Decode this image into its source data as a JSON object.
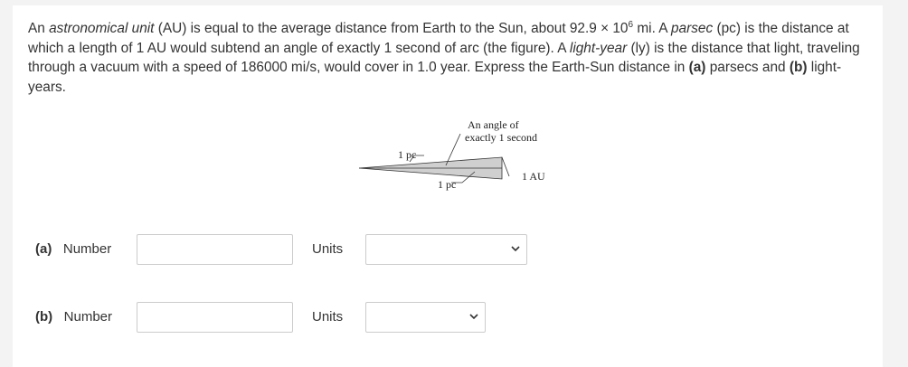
{
  "problem": {
    "p1": "An ",
    "p2": "astronomical unit",
    "p3": " (AU) is equal to the average distance from Earth to the Sun, about 92.9 × 10",
    "p3_sup": "6",
    "p4": " mi. A ",
    "p5": "parsec",
    "p6": " (pc) is the distance at which a length of 1 AU would subtend an angle of exactly 1 second of arc (the figure). A ",
    "p7": "light-year",
    "p8": " (ly) is the distance that light, traveling through a vacuum with a speed of 186000 mi/s, would cover in 1.0 year. Express the Earth-Sun distance in ",
    "p9": "(a)",
    "p10": " parsecs and ",
    "p11": "(b)",
    "p12": " light-years."
  },
  "figure": {
    "angle_line1": "An angle of",
    "angle_line2": "exactly 1 second",
    "pc_top": "1 pc",
    "pc_bottom": "1 pc",
    "au": "1 AU"
  },
  "rows": [
    {
      "part": "(a)",
      "number_label": "Number",
      "number_value": "",
      "units_label": "Units",
      "units_value": ""
    },
    {
      "part": "(b)",
      "number_label": "Number",
      "number_value": "",
      "units_label": "Units",
      "units_value": ""
    }
  ],
  "icons": {
    "dropdown": "chevron-down-icon"
  },
  "colors": {
    "border": "#cccccc",
    "text": "#333333",
    "figure_fill": "#cfcfcf"
  }
}
